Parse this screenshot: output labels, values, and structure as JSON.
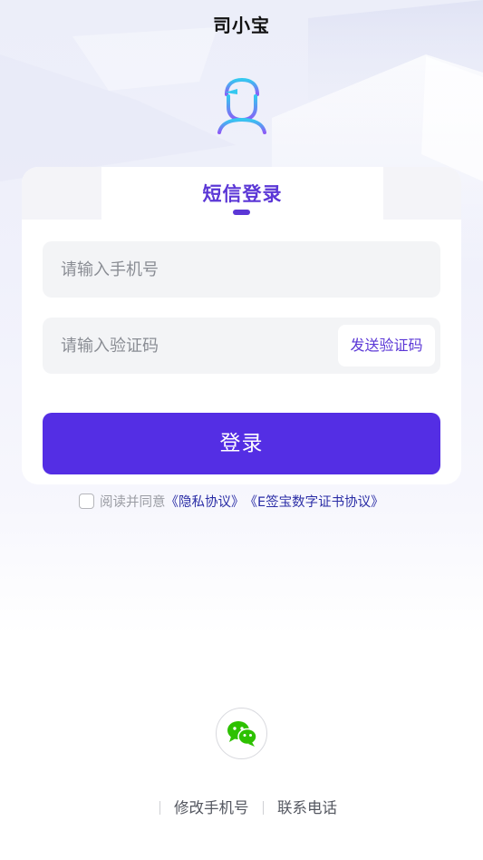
{
  "header": {
    "title": "司小宝"
  },
  "login_card": {
    "tab_label": "短信登录",
    "phone_placeholder": "请输入手机号",
    "code_placeholder": "请输入验证码",
    "send_code_label": "发送验证码",
    "login_label": "登录"
  },
  "agreement": {
    "checked": false,
    "text": "阅读并同意",
    "privacy_link": "《隐私协议》",
    "cert_link": "《E签宝数字证书协议》"
  },
  "footer": {
    "wechat_icon": "wechat-icon",
    "change_phone": "修改手机号",
    "contact_phone": "联系电话"
  },
  "colors": {
    "accent": "#542ee4",
    "tab_text": "#5b37d6",
    "link": "#2b2ea6",
    "wechat_green": "#2dc100"
  }
}
